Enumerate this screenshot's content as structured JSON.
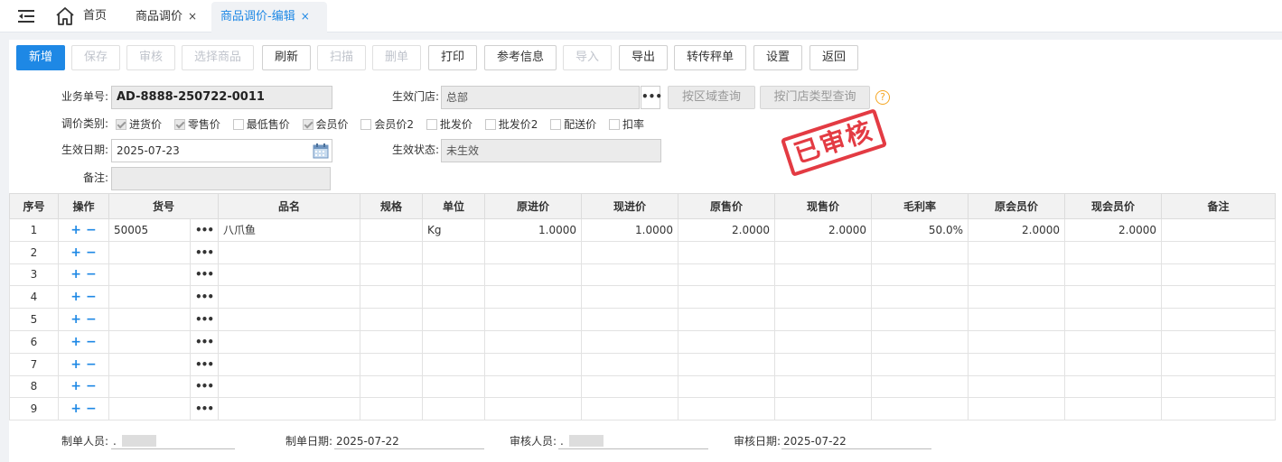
{
  "tabs": {
    "home": "首页",
    "items": [
      {
        "label": "商品调价",
        "close": "×"
      },
      {
        "label": "商品调价-编辑",
        "close": "×"
      }
    ]
  },
  "toolbar": {
    "buttons": [
      {
        "label": "新增",
        "state": "primary"
      },
      {
        "label": "保存",
        "state": "disabled"
      },
      {
        "label": "审核",
        "state": "disabled"
      },
      {
        "label": "选择商品",
        "state": "disabled"
      },
      {
        "label": "刷新",
        "state": "normal"
      },
      {
        "label": "扫描",
        "state": "disabled"
      },
      {
        "label": "删单",
        "state": "disabled"
      },
      {
        "label": "打印",
        "state": "normal"
      },
      {
        "label": "参考信息",
        "state": "normal"
      },
      {
        "label": "导入",
        "state": "disabled"
      },
      {
        "label": "导出",
        "state": "normal"
      },
      {
        "label": "转传秤单",
        "state": "normal"
      },
      {
        "label": "设置",
        "state": "normal"
      },
      {
        "label": "返回",
        "state": "normal"
      }
    ]
  },
  "form": {
    "order_no_label": "业务单号:",
    "order_no": "AD-8888-250722-0011",
    "store_label": "生效门店:",
    "store": "总部",
    "ellipsis": "•••",
    "by_region_btn": "按区域查询",
    "by_store_type_btn": "按门店类型查询",
    "help": "?",
    "price_type_label": "调价类别:",
    "price_types": [
      {
        "label": "进货价",
        "checked": true
      },
      {
        "label": "零售价",
        "checked": true
      },
      {
        "label": "最低售价",
        "checked": false
      },
      {
        "label": "会员价",
        "checked": true
      },
      {
        "label": "会员价2",
        "checked": false
      },
      {
        "label": "批发价",
        "checked": false
      },
      {
        "label": "批发价2",
        "checked": false
      },
      {
        "label": "配送价",
        "checked": false
      },
      {
        "label": "扣率",
        "checked": false
      }
    ],
    "effective_date_label": "生效日期:",
    "effective_date": "2025-07-23",
    "status_label": "生效状态:",
    "status": "未生效",
    "remark_label": "备注:",
    "remark": ""
  },
  "stamp": "已审核",
  "grid": {
    "columns": [
      "序号",
      "操作",
      "货号",
      "品名",
      "规格",
      "单位",
      "原进价",
      "现进价",
      "原售价",
      "现售价",
      "毛利率",
      "原会员价",
      "现会员价",
      "备注"
    ],
    "op_add": "+",
    "op_del": "−",
    "dots": "•••",
    "rows": [
      {
        "no": "1",
        "code": "50005",
        "name": "八爪鱼",
        "spec": "",
        "unit": "Kg",
        "old_cost": "1.0000",
        "new_cost": "1.0000",
        "old_price": "2.0000",
        "new_price": "2.0000",
        "margin": "50.0%",
        "old_member": "2.0000",
        "new_member": "2.0000",
        "remark": ""
      },
      {
        "no": "2"
      },
      {
        "no": "3"
      },
      {
        "no": "4"
      },
      {
        "no": "5"
      },
      {
        "no": "6"
      },
      {
        "no": "7"
      },
      {
        "no": "8"
      },
      {
        "no": "9"
      }
    ]
  },
  "footer": {
    "maker_label": "制单人员:",
    "maker": ".",
    "make_date_label": "制单日期:",
    "make_date": "2025-07-22",
    "auditor_label": "审核人员:",
    "auditor": ".",
    "audit_date_label": "审核日期:",
    "audit_date": "2025-07-22"
  }
}
